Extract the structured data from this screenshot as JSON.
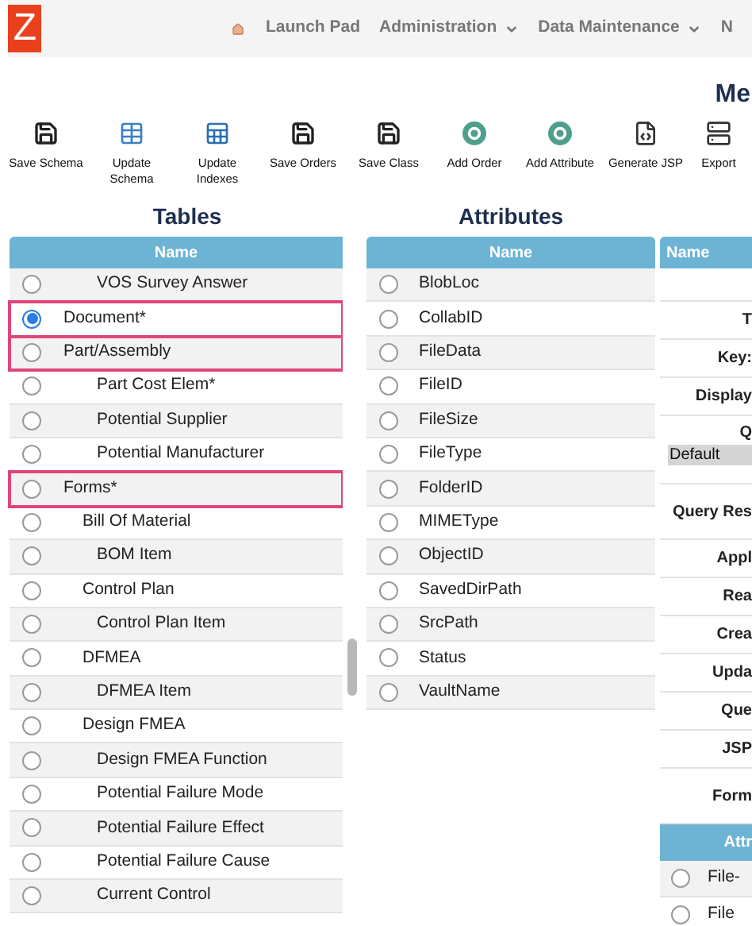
{
  "logo": "Z",
  "nav": [
    {
      "label": "Launch Pad",
      "dropdown": false
    },
    {
      "label": "Administration",
      "dropdown": true
    },
    {
      "label": "Data Maintenance",
      "dropdown": true
    },
    {
      "label": "N",
      "dropdown": false
    }
  ],
  "page_title": "Me",
  "toolbar": [
    {
      "label": "Save Schema",
      "kind": "floppy"
    },
    {
      "label": "Update\nSchema",
      "kind": "grid"
    },
    {
      "label": "Update\nIndexes",
      "kind": "index"
    },
    {
      "label": "Save Orders",
      "kind": "floppy"
    },
    {
      "label": "Save Class",
      "kind": "floppy"
    },
    {
      "label": "Add Order",
      "kind": "ring"
    },
    {
      "label": "Add Attribute",
      "kind": "ring"
    },
    {
      "label": "Generate JSP",
      "kind": "doc"
    },
    {
      "label": "Export",
      "kind": "server"
    }
  ],
  "tables": {
    "title": "Tables",
    "column": "Name",
    "rows": [
      {
        "children": [
          {
            "children": [
              {
                "name": "VOS Survey Answer",
                "selected": false,
                "highlighted": false
              }
            ]
          }
        ]
      },
      {
        "name": "Document*",
        "selected": true,
        "highlighted": true
      },
      {
        "name": "Part/Assembly",
        "selected": false,
        "highlighted": true,
        "children": [
          {
            "children": [
              {
                "name": "Part Cost Elem*",
                "selected": false,
                "highlighted": false
              },
              {
                "name": "Potential Supplier",
                "selected": false,
                "highlighted": false
              },
              {
                "name": "Potential Manufacturer",
                "selected": false,
                "highlighted": false
              }
            ]
          }
        ]
      },
      {
        "name": "Forms*",
        "selected": false,
        "highlighted": true,
        "children": [
          {
            "name": "Bill Of Material",
            "selected": false,
            "highlighted": false,
            "children": [
              {
                "name": "BOM Item",
                "selected": false,
                "highlighted": false
              }
            ]
          },
          {
            "name": "Control Plan",
            "selected": false,
            "highlighted": false,
            "children": [
              {
                "name": "Control Plan Item",
                "selected": false,
                "highlighted": false
              }
            ]
          },
          {
            "name": "DFMEA",
            "selected": false,
            "highlighted": false,
            "children": [
              {
                "name": "DFMEA Item",
                "selected": false,
                "highlighted": false
              }
            ]
          },
          {
            "name": "Design FMEA",
            "selected": false,
            "highlighted": false,
            "children": [
              {
                "name": "Design FMEA Function",
                "selected": false,
                "highlighted": false
              },
              {
                "name": "Potential Failure Mode",
                "selected": false,
                "highlighted": false
              },
              {
                "name": "Potential Failure Effect",
                "selected": false,
                "highlighted": false
              },
              {
                "name": "Potential Failure Cause",
                "selected": false,
                "highlighted": false
              },
              {
                "name": "Current Control",
                "selected": false,
                "highlighted": false
              }
            ]
          }
        ]
      }
    ]
  },
  "attributes": {
    "title": "Attributes",
    "column": "Name",
    "rows": [
      {
        "name": "BlobLoc",
        "selected": false
      },
      {
        "name": "CollabID",
        "selected": false
      },
      {
        "name": "FileData",
        "selected": false
      },
      {
        "name": "FileID",
        "selected": false
      },
      {
        "name": "FileSize",
        "selected": false
      },
      {
        "name": "FileType",
        "selected": false
      },
      {
        "name": "FolderID",
        "selected": false
      },
      {
        "name": "MIMEType",
        "selected": false
      },
      {
        "name": "ObjectID",
        "selected": false
      },
      {
        "name": "SavedDirPath",
        "selected": false
      },
      {
        "name": "SrcPath",
        "selected": false
      },
      {
        "name": "Status",
        "selected": false
      },
      {
        "name": "VaultName",
        "selected": false
      }
    ]
  },
  "details": {
    "column": "Name",
    "rows": [
      {
        "kind": "blank"
      },
      {
        "kind": "label",
        "label": "T"
      },
      {
        "kind": "label",
        "label": "Key:"
      },
      {
        "kind": "label",
        "label": "Display"
      },
      {
        "kind": "short_label",
        "label": "Q"
      },
      {
        "kind": "select",
        "value": "Default"
      },
      {
        "kind": "tall_label",
        "label": "Query Res"
      },
      {
        "kind": "label",
        "label": "Appl"
      },
      {
        "kind": "label",
        "label": "Rea"
      },
      {
        "kind": "label",
        "label": "Crea"
      },
      {
        "kind": "label",
        "label": "Upda"
      },
      {
        "kind": "label",
        "label": "Que"
      },
      {
        "kind": "label",
        "label": "JSP"
      },
      {
        "kind": "tall_label",
        "label": "Form"
      },
      {
        "kind": "header",
        "label": "Attr"
      },
      {
        "kind": "radio",
        "label": "File-",
        "selected": false
      },
      {
        "kind": "radio",
        "label": "File",
        "selected": false
      }
    ]
  }
}
